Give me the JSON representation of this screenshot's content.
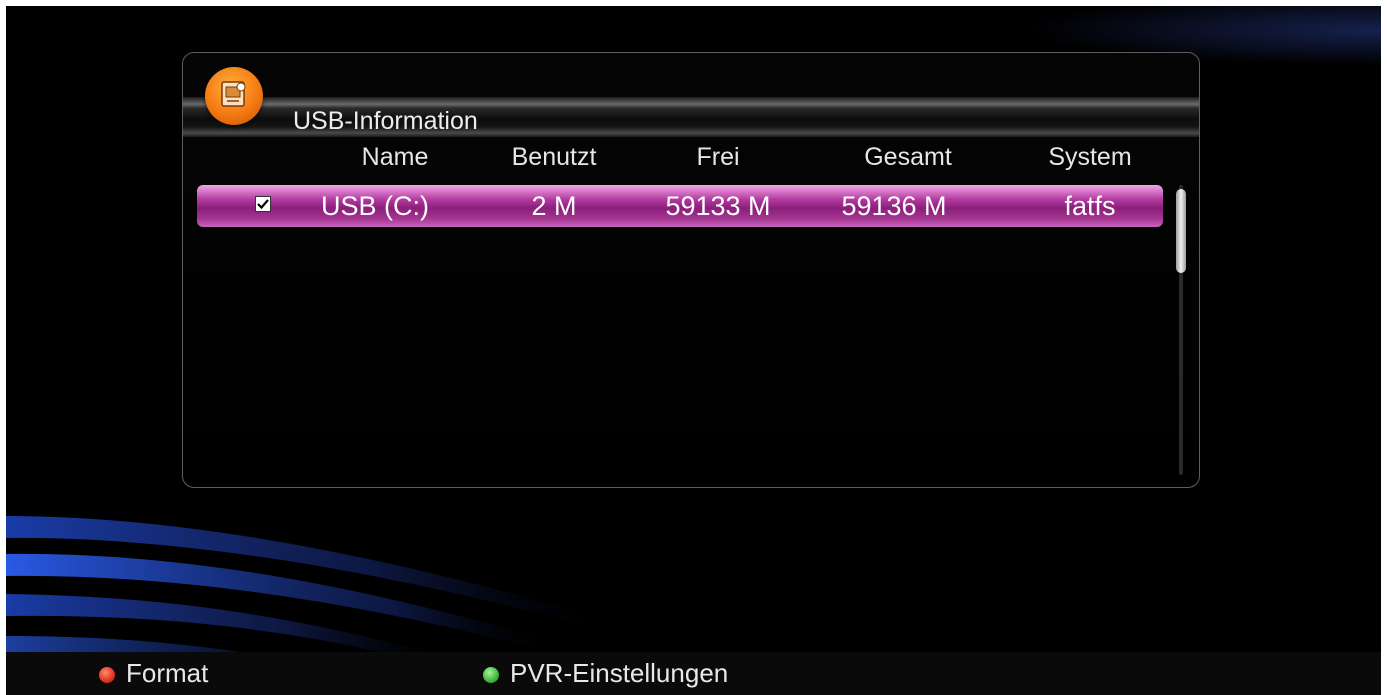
{
  "dialog": {
    "title": "USB-Information",
    "icon": "usb-device-icon",
    "accent_color": "#f47a12"
  },
  "table": {
    "columns": [
      "Name",
      "Benutzt",
      "Frei",
      "Gesamt",
      "System"
    ],
    "rows": [
      {
        "selected": true,
        "checked": true,
        "name": "USB (C:)",
        "used": "2 M",
        "free": "59133 M",
        "total": "59136 M",
        "system": "fatfs"
      }
    ],
    "highlight_color": "#a53592"
  },
  "footer": {
    "buttons": [
      {
        "label": "Format",
        "color": "#e0321e",
        "icon": "red-button-icon"
      },
      {
        "label": "PVR-Einstellungen",
        "color": "#3fb83a",
        "icon": "green-button-icon"
      }
    ]
  }
}
